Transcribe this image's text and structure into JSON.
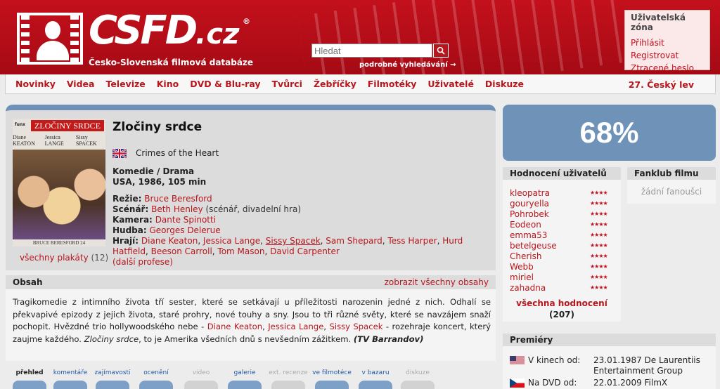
{
  "header": {
    "logo_text": "CSFD",
    "logo_tld": ".cz",
    "logo_reg": "®",
    "subtitle": "Česko-Slovenská filmová databáze",
    "search_placeholder": "Hledat",
    "advanced_search": "podrobné vyhledávání →",
    "user_zone": {
      "title": "Uživatelská zóna",
      "links": [
        "Přihlásit",
        "Registrovat",
        "Ztracené heslo"
      ]
    }
  },
  "nav": {
    "items": [
      "Novinky",
      "Videa",
      "Televize",
      "Kino",
      "DVD & Blu-ray",
      "Tvůrci",
      "Žebříčky",
      "Filmotéky",
      "Uživatelé",
      "Diskuze"
    ],
    "right": "27. Český lev"
  },
  "film": {
    "title": "Zločiny srdce",
    "original_title": "Crimes of the Heart",
    "genre": "Komedie / Drama",
    "origin": "USA, 1986, 105 min",
    "poster": {
      "brand": "funx",
      "title": "ZLOČINY SRDCE",
      "names": [
        "Diane KEATON",
        "Jessica LANGE",
        "Sissy SPACEK"
      ],
      "director": "BRUCE BERESFORD",
      "badge": "24"
    },
    "posters_link": "všechny plakáty",
    "posters_count": "(12)",
    "creators": {
      "directing_label": "Režie:",
      "directing": "Bruce Beresford",
      "screenplay_label": "Scénář:",
      "screenplay": "Beth Henley",
      "screenplay_note": "(scénář, divadelní hra)",
      "camera_label": "Kamera:",
      "camera": "Dante Spinotti",
      "music_label": "Hudba:",
      "music": "Georges Delerue",
      "cast_label": "Hrají:",
      "cast": [
        "Diane Keaton",
        "Jessica Lange",
        "Sissy Spacek",
        "Sam Shepard",
        "Tess Harper",
        "Hurd Hatfield",
        "Beeson Carroll",
        "Tom Mason",
        "David Carpenter"
      ],
      "more": "(další profese)"
    }
  },
  "obsah": {
    "title": "Obsah",
    "show_all": "zobrazit všechny obsahy",
    "p1": "Tragikomedie z intimního života tří sester, které se setkávají u příležitosti narozenin jedné z nich. Odhalí se překvapivé epizody z jejich života, staré prohry, nové touhy a sny. Jsou to tři různé světy, které se navzájem snaží pochopit. Hvězdné trio hollywoodského nebe - ",
    "a1": "Diane Keaton",
    "sep1": ", ",
    "a2": "Jessica Lange",
    "sep2": ", ",
    "a3": "Sissy Spacek",
    "p2": " - rozehraje koncert, který zaujme každého. ",
    "p3_italic": "Zločiny srdce",
    "p4": ", to je Amerika všedních dnů s nevšedním zážitkem. ",
    "source": "(TV Barrandov)"
  },
  "tabs": [
    "přehled",
    "komentáře",
    "zajímavosti",
    "ocenění",
    "video",
    "galerie",
    "ext. recenze",
    "ve filmotéce",
    "v bazaru",
    "diskuze"
  ],
  "rating": {
    "value": "68%"
  },
  "user_ratings": {
    "title": "Hodnocení uživatelů",
    "users": [
      "kleopatra",
      "gouryella",
      "Pohrobek",
      "Eodeon",
      "emma53",
      "betelgeuse",
      "Cherish",
      "Webb",
      "miriel",
      "zahadna"
    ],
    "stars": "★★★★",
    "all_label": "všechna hodnocení",
    "count": "(207)"
  },
  "fanklub": {
    "title": "Fanklub filmu",
    "empty": "žádní fanoušci"
  },
  "premiery": {
    "title": "Premiéry",
    "rows": [
      {
        "label": "V kinech od:",
        "value": "23.01.1987 De Laurentiis Entertainment Group"
      },
      {
        "label": "Na DVD od:",
        "value": "22.01.2009 FilmX"
      }
    ]
  },
  "colors": {
    "brand_red": "#c3101c",
    "link_red": "#b8161c",
    "panel_blue": "#6f92b9"
  }
}
